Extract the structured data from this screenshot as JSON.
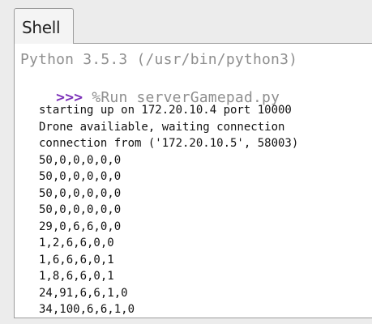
{
  "tab": {
    "label": "Shell"
  },
  "shell": {
    "banner": "Python 3.5.3 (/usr/bin/python3)",
    "prompt": ">>>",
    "command": "%Run serverGamepad.py",
    "output": [
      "starting up on 172.20.10.4 port 10000",
      "Drone availiable, waiting connection",
      "connection from ('172.20.10.5', 58003)",
      "50,0,0,0,0,0",
      "50,0,0,0,0,0",
      "50,0,0,0,0,0",
      "50,0,0,0,0,0",
      "29,0,6,6,0,0",
      "1,2,6,6,0,0",
      "1,6,6,6,0,1",
      "1,8,6,6,0,1",
      "24,91,6,6,1,0",
      "34,100,6,6,1,0"
    ]
  },
  "colors": {
    "prompt": "#7b2fb8",
    "muted_text": "#8f8f8f",
    "output_text": "#111111",
    "background": "#ececec"
  }
}
